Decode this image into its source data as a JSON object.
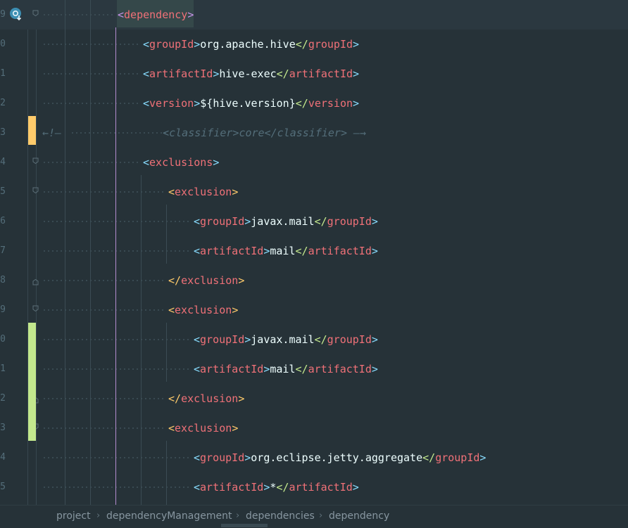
{
  "editor": {
    "lines": [
      {
        "num": "9",
        "text": "<dependency>"
      },
      {
        "num": "0",
        "text": "<groupId>org.apache.hive</groupId>"
      },
      {
        "num": "1",
        "text": "<artifactId>hive-exec</artifactId>"
      },
      {
        "num": "2",
        "text": "<version>${hive.version}</version>"
      },
      {
        "num": "3",
        "text": "<!--<classifier>core</classifier>-->"
      },
      {
        "num": "4",
        "text": "<exclusions>"
      },
      {
        "num": "5",
        "text": "<exclusion>"
      },
      {
        "num": "6",
        "text": "<groupId>javax.mail</groupId>"
      },
      {
        "num": "7",
        "text": "<artifactId>mail</artifactId>"
      },
      {
        "num": "8",
        "text": "</exclusion>"
      },
      {
        "num": "9",
        "text": "<exclusion>"
      },
      {
        "num": "0",
        "text": "<groupId>javax.mail</groupId>"
      },
      {
        "num": "1",
        "text": "<artifactId>mail</artifactId>"
      },
      {
        "num": "2",
        "text": "</exclusion>"
      },
      {
        "num": "3",
        "text": "<exclusion>"
      },
      {
        "num": "4",
        "text": "<groupId>org.eclipse.jetty.aggregate</groupId>"
      },
      {
        "num": "5",
        "text": "<artifactId>*</artifactId>"
      }
    ],
    "gutter_icon": "maven-dependency-icon",
    "colors": {
      "background": "#263238",
      "tag": "#f07178",
      "bracket": "#89ddff",
      "text": "#eeffff",
      "comment": "#546e7a",
      "modified_marker": "#ffcb6b",
      "added_marker": "#c3e88d"
    }
  },
  "breadcrumb": {
    "items": [
      "project",
      "dependencyManagement",
      "dependencies",
      "dependency"
    ]
  }
}
